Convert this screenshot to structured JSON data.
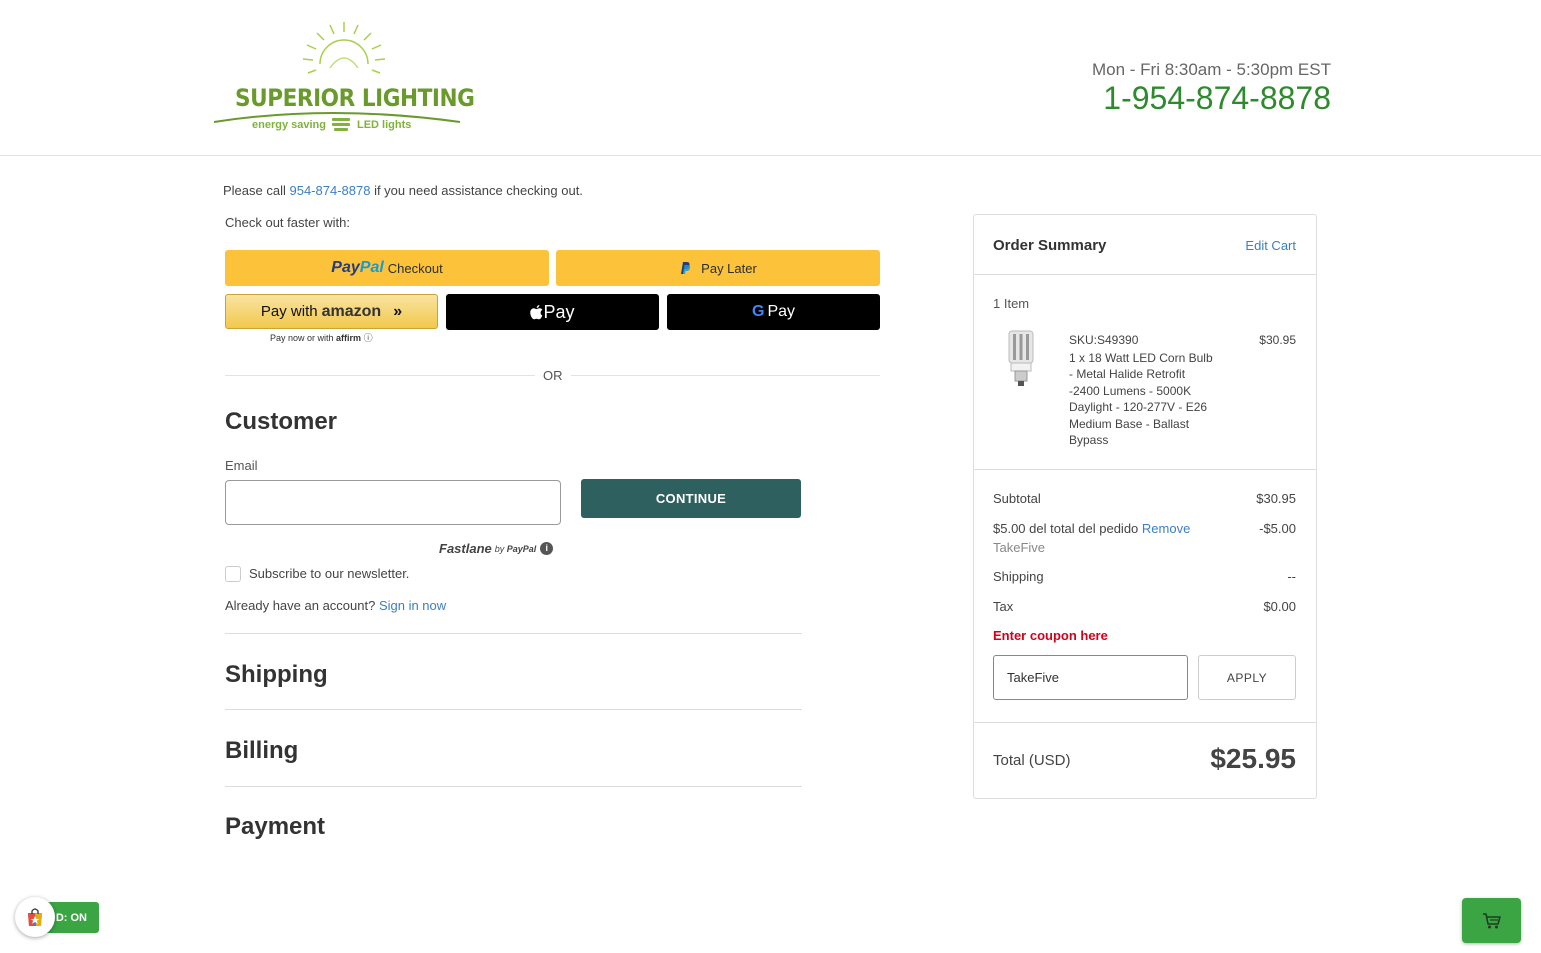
{
  "header": {
    "logo_brand": "SUPERIOR LIGHTING",
    "logo_tag_left": "energy saving",
    "logo_tag_right": "LED lights",
    "hours": "Mon - Fri 8:30am - 5:30pm EST",
    "phone": "1-954-874-8878"
  },
  "checkout": {
    "assist_prefix": "Please call ",
    "assist_phone": "954-874-8878",
    "assist_suffix": " if you need assistance checking out.",
    "faster": "Check out faster with:",
    "paypal": {
      "pay": "Pay",
      "pal": "Pal",
      "label": "Checkout"
    },
    "paylater": {
      "label": "Pay Later"
    },
    "amazon": {
      "prefix": "Pay with",
      "brand": "amazon",
      "arrows": "»"
    },
    "affirm": {
      "prefix": "Pay now or with",
      "brand": "affirm",
      "info": "ⓘ"
    },
    "applepay": {
      "label": " Pay"
    },
    "gpay": {
      "g": "G",
      "label": "Pay"
    },
    "or": "OR"
  },
  "customer": {
    "title": "Customer",
    "email_label": "Email",
    "email_value": "",
    "continue": "CONTINUE",
    "fastlane": "Fastlane",
    "fastlane_by": "by",
    "fastlane_paypal": "PayPal",
    "fastlane_info": "i",
    "subscribe": "Subscribe to our newsletter.",
    "already": "Already have an account? ",
    "signin": "Sign in now"
  },
  "sections": {
    "shipping": "Shipping",
    "billing": "Billing",
    "payment": "Payment"
  },
  "summary": {
    "title": "Order Summary",
    "edit_cart": "Edit Cart",
    "item_count": "1 Item",
    "item": {
      "sku": "SKU:S49390",
      "name": "1 x 18 Watt LED Corn Bulb - Metal Halide Retrofit -2400 Lumens - 5000K Daylight - 120-277V - E26 Medium Base - Ballast Bypass",
      "price": "$30.95"
    },
    "subtotal_label": "Subtotal",
    "subtotal": "$30.95",
    "discount_label": "$5.00 del total del pedido ",
    "discount_remove": "Remove",
    "discount_code": "TakeFive",
    "discount": "-$5.00",
    "shipping_label": "Shipping",
    "shipping": "--",
    "tax_label": "Tax",
    "tax": "$0.00",
    "coupon_label": "Enter coupon here",
    "coupon_value": "TakeFive",
    "apply": "APPLY",
    "total_label": "Total (USD)",
    "total": "$25.95"
  },
  "widgets": {
    "extension_status": "D: ON"
  },
  "colors": {
    "brand_green": "#2d8a2d",
    "continue_bg": "#2e6060",
    "paypal_yellow": "#fcc33a",
    "link_blue": "#3b7fc4",
    "coupon_red": "#d0021b"
  }
}
